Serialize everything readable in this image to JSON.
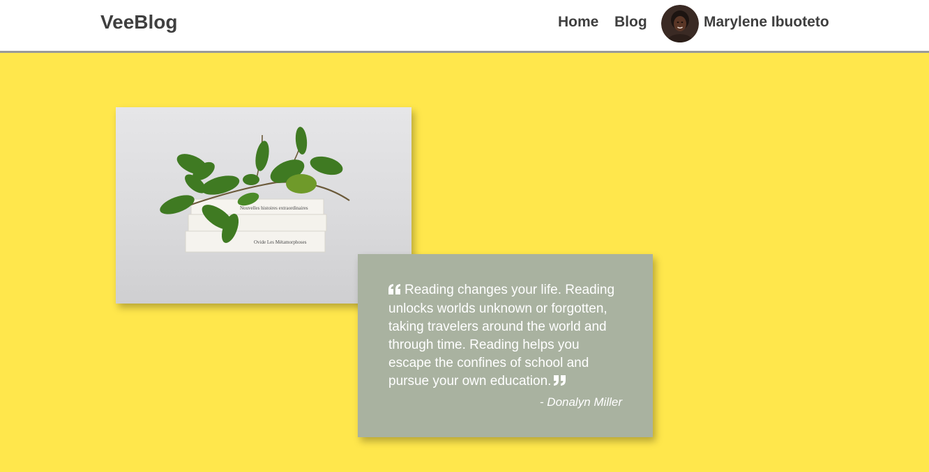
{
  "navbar": {
    "brand": "VeeBlog",
    "links": [
      {
        "label": "Home"
      },
      {
        "label": "Blog"
      }
    ],
    "user": {
      "name": "Marylene Ibuoteto"
    }
  },
  "hero": {
    "background_color": "#ffe74c",
    "photo": {
      "book_titles": [
        "Nouvelles histoires extraordinaires",
        "Ovide Les Métamorphoses"
      ]
    },
    "quote": {
      "text": "Reading changes your life. Reading unlocks worlds unknown or forgotten, taking travelers around the world and through time. Reading helps you escape the confines of school and pursue your own education.",
      "author": "- Donalyn Miller",
      "background_color": "#a9b2a0"
    }
  }
}
